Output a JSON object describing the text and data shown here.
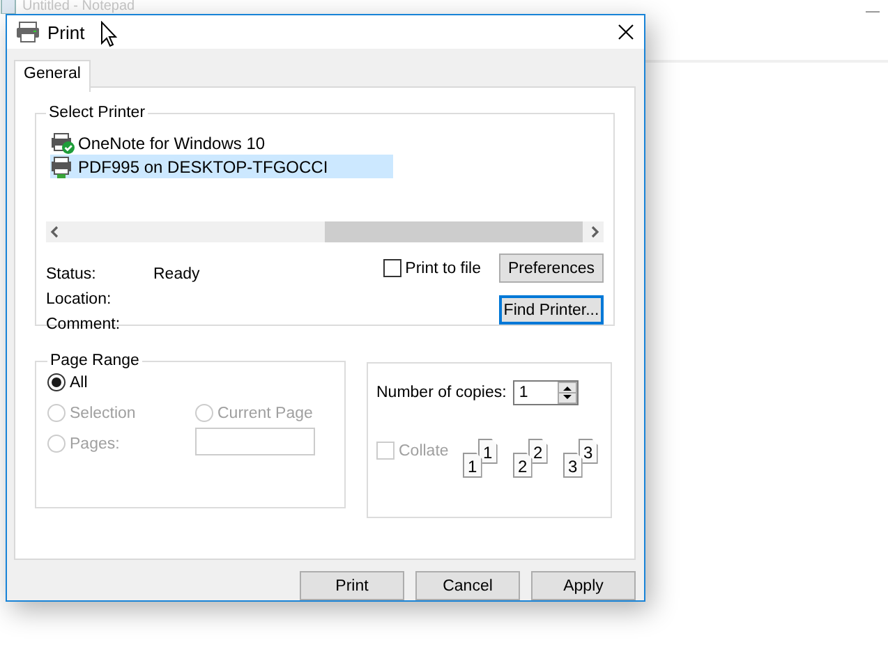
{
  "background_window": {
    "title": "Untitled - Notepad"
  },
  "window": {
    "title": "Print"
  },
  "tabs": [
    {
      "label": "General",
      "selected": true
    }
  ],
  "select_printer": {
    "title": "Select Printer",
    "printers": [
      {
        "name": "OneNote for Windows 10",
        "is_default": true,
        "selected": false
      },
      {
        "name": "PDF995 on DESKTOP-TFGOCCI",
        "is_default": false,
        "selected": true
      }
    ],
    "details": [
      {
        "label": "Status:",
        "value": "Ready"
      },
      {
        "label": "Location:"
      },
      {
        "label": "Comment:"
      }
    ],
    "print_to_file": {
      "label": "Print to file",
      "checked": false
    },
    "preferences_button": "Preferences",
    "find_printer_button": {
      "label": "Find Printer...",
      "focused": true
    }
  },
  "page_range": {
    "title": "Page Range",
    "options": [
      {
        "label": "All",
        "selected": true,
        "disabled": false
      },
      {
        "label": "Selection",
        "selected": false,
        "disabled": true
      },
      {
        "label": "Current Page",
        "selected": false,
        "disabled": true
      },
      {
        "label": "Pages:",
        "selected": false,
        "disabled": true
      }
    ]
  },
  "copies": {
    "label": "Number of copies:",
    "value": "1",
    "collate": {
      "label": "Collate",
      "checked": false,
      "disabled": true
    },
    "collate_sample": [
      {
        "back": "1",
        "front": "1"
      },
      {
        "back": "2",
        "front": "2"
      },
      {
        "back": "3",
        "front": "3"
      }
    ]
  },
  "buttons": [
    {
      "label": "Print"
    },
    {
      "label": "Cancel"
    },
    {
      "label": "Apply"
    }
  ]
}
